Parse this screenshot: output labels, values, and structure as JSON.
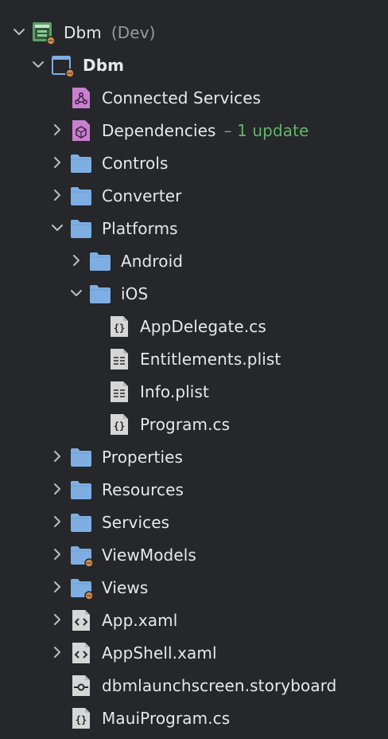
{
  "solution": {
    "name": "Dbm",
    "config": "(Dev)"
  },
  "project": {
    "name": "Dbm"
  },
  "items": {
    "connected_services": "Connected Services",
    "dependencies": "Dependencies",
    "dependencies_update": "– 1 update",
    "controls": "Controls",
    "converter": "Converter",
    "platforms": "Platforms",
    "android": "Android",
    "ios": "iOS",
    "appdelegate": "AppDelegate.cs",
    "entitlements": "Entitlements.plist",
    "infoplist": "Info.plist",
    "programcs": "Program.cs",
    "properties": "Properties",
    "resources": "Resources",
    "services": "Services",
    "viewmodels": "ViewModels",
    "views": "Views",
    "appxaml": "App.xaml",
    "appshellxaml": "AppShell.xaml",
    "storyboard": "dbmlaunchscreen.storyboard",
    "mauiprogram": "MauiProgram.cs"
  },
  "icons": {
    "folder": "folder-icon",
    "code_file": "code-file-icon",
    "plist_file": "plist-file-icon",
    "xaml_file": "xaml-file-icon",
    "storyboard_file": "storyboard-file-icon",
    "solution": "solution-icon",
    "project": "project-icon",
    "connected_services": "connected-services-icon",
    "dependencies": "dependencies-icon"
  },
  "colors": {
    "background": "#25272a",
    "folder": "#7eaee2",
    "purple": "#c97fd0",
    "update_text": "#62b56a",
    "config_text": "#9a9a9a",
    "badge": "#d58a4d"
  }
}
